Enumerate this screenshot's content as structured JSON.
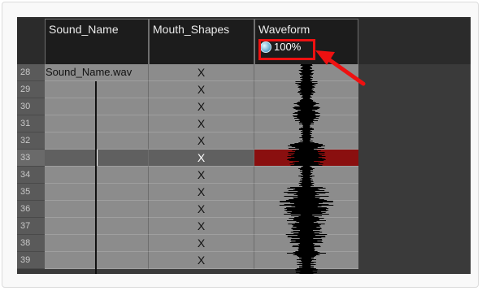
{
  "columns": {
    "sound_name": "Sound_Name",
    "mouth_shapes": "Mouth_Shapes",
    "waveform": "Waveform",
    "waveform_zoom": "100%"
  },
  "rows": [
    {
      "frame": "28",
      "sound": "Sound_Name.wav",
      "mouth": "X"
    },
    {
      "frame": "29",
      "sound": "",
      "mouth": "X"
    },
    {
      "frame": "30",
      "sound": "",
      "mouth": "X"
    },
    {
      "frame": "31",
      "sound": "",
      "mouth": "X"
    },
    {
      "frame": "32",
      "sound": "",
      "mouth": "X"
    },
    {
      "frame": "33",
      "sound": "",
      "mouth": "X",
      "selected": true
    },
    {
      "frame": "34",
      "sound": "",
      "mouth": "X"
    },
    {
      "frame": "35",
      "sound": "",
      "mouth": "X"
    },
    {
      "frame": "36",
      "sound": "",
      "mouth": "X"
    },
    {
      "frame": "37",
      "sound": "",
      "mouth": "X"
    },
    {
      "frame": "38",
      "sound": "",
      "mouth": "X"
    },
    {
      "frame": "39",
      "sound": "",
      "mouth": "X"
    }
  ],
  "icons": {
    "zoom": "globe-zoom-icon"
  },
  "colors": {
    "highlight": "#ee1111",
    "selected_waveform": "#8a0f0f",
    "cell": "#8c8c8c"
  }
}
